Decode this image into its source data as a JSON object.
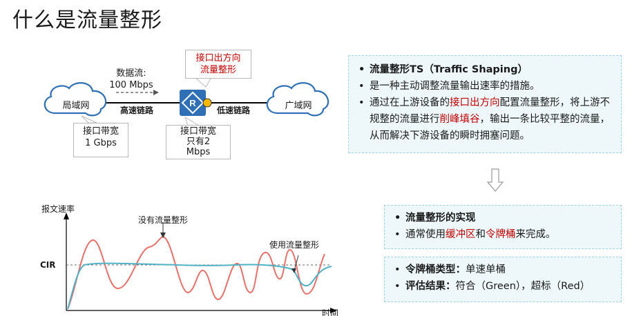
{
  "title": "什么是流量整形",
  "network": {
    "left_cloud": "局域网",
    "right_cloud": "广域网",
    "flow_label_line1": "数据流:",
    "flow_label_line2": "100 Mbps",
    "high_speed_link": "高速链路",
    "low_speed_link": "低速链路",
    "left_bandwidth_line1": "接口带宽",
    "left_bandwidth_line2": "1 Gbps",
    "router_bandwidth_line1": "接口带宽",
    "router_bandwidth_line2": "只有2",
    "router_bandwidth_line3": "Mbps",
    "outbound_line1": "接口出方向",
    "outbound_line2": "流量整形",
    "router_letter": "R"
  },
  "definition_panel": {
    "heading": "流量整形TS（Traffic Shaping）",
    "item1": "是一种主动调整流量输出速率的措施。",
    "item2_part1": "通过在上游设备的",
    "item2_highlight1": "接口出方向",
    "item2_part2": "配置流量整形，将上游不规整的流量进行",
    "item2_highlight2": "削峰填谷",
    "item2_part3": "，输出一条比较平整的流量，从而解决下游设备的瞬时拥塞问题。"
  },
  "implementation_panel": {
    "heading": "流量整形的实现",
    "text_part1": "通常使用",
    "highlight1": "缓冲区",
    "text_part2": "和",
    "highlight2": "令牌桶",
    "text_part3": "来完成。"
  },
  "bucket_panel": {
    "type_label": "令牌桶类型：",
    "type_value": "单速单桶",
    "result_label": "评估结果：",
    "result_value": "符合（Green），超标（Red）"
  },
  "chart": {
    "y_axis_label": "报文速率",
    "x_axis_label": "时间",
    "cir_label": "CIR",
    "unshaped_label": "没有流量整形",
    "shaped_label": "使用流量整形"
  },
  "colors": {
    "unshaped_line": "#e8706a",
    "shaped_line": "#4fb0c6",
    "router": "#2e6fb5",
    "accent_red": "#c00000",
    "panel_bg": "#eef8fb"
  }
}
